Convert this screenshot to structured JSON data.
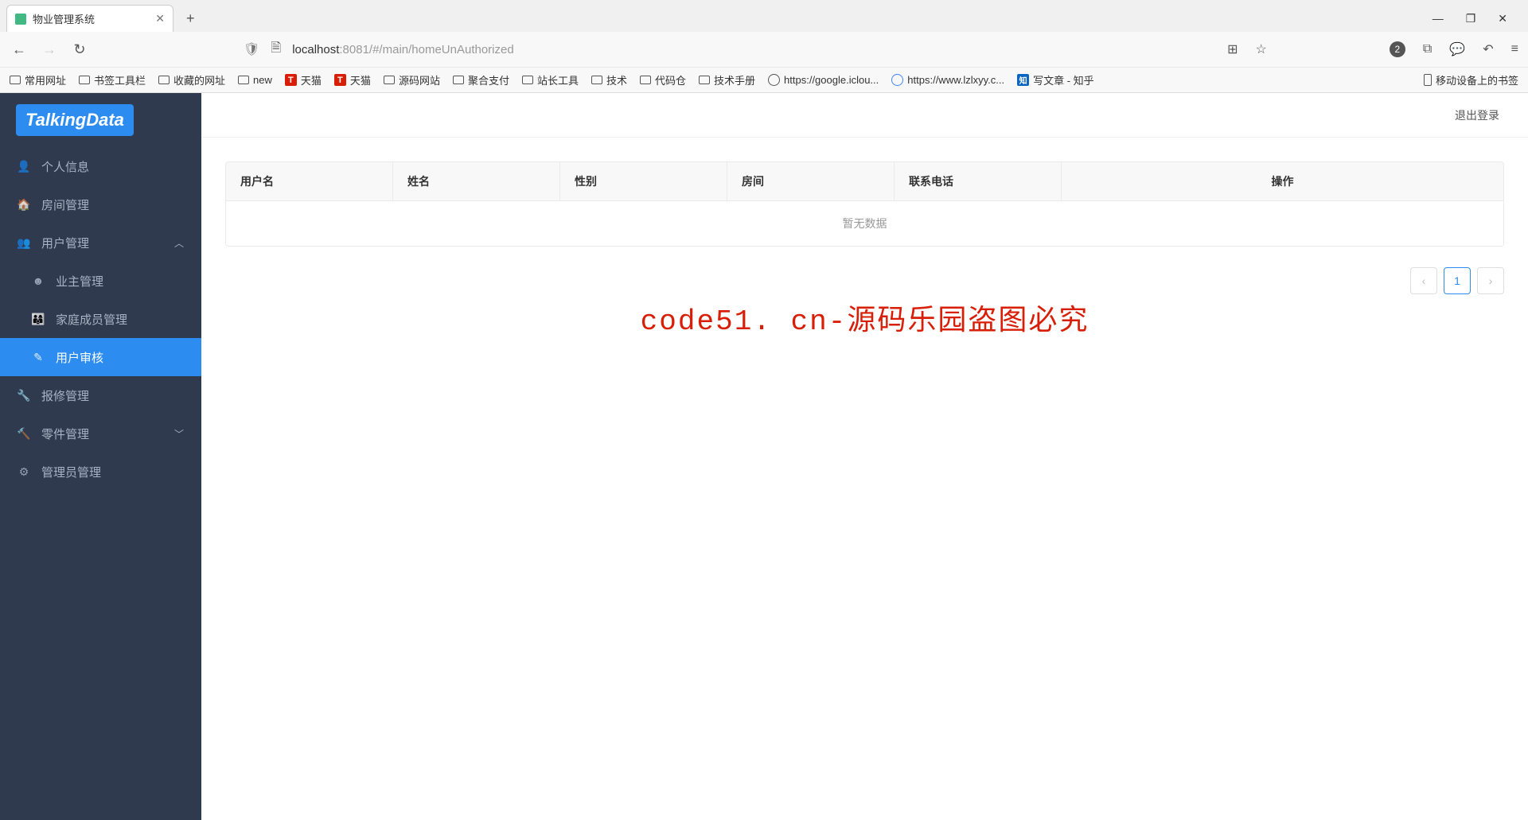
{
  "browser": {
    "tab_title": "物业管理系统",
    "url_prefix": "localhost",
    "url_rest": ":8081/#/main/homeUnAuthorized",
    "badge": "2",
    "bookmarks": [
      {
        "type": "folder",
        "label": "常用网址"
      },
      {
        "type": "folder",
        "label": "书签工具栏"
      },
      {
        "type": "folder",
        "label": "收藏的网址"
      },
      {
        "type": "folder",
        "label": "new"
      },
      {
        "type": "tmall",
        "label": "天猫"
      },
      {
        "type": "tmall",
        "label": "天猫"
      },
      {
        "type": "folder",
        "label": "源码网站"
      },
      {
        "type": "folder",
        "label": "聚合支付"
      },
      {
        "type": "folder",
        "label": "站长工具"
      },
      {
        "type": "folder",
        "label": "技术"
      },
      {
        "type": "folder",
        "label": "代码仓"
      },
      {
        "type": "folder",
        "label": "技术手册"
      },
      {
        "type": "globe",
        "label": "https://google.iclou..."
      },
      {
        "type": "google",
        "label": "https://www.lzlxyy.c..."
      },
      {
        "type": "zhihu",
        "label": "写文章 - 知乎"
      }
    ],
    "bookmark_right": "移动设备上的书签"
  },
  "app": {
    "logo": "TalkingData",
    "logout": "退出登录",
    "menu": {
      "personal": "个人信息",
      "room": "房间管理",
      "user": "用户管理",
      "owner": "业主管理",
      "family": "家庭成员管理",
      "audit": "用户审核",
      "repair": "报修管理",
      "parts": "零件管理",
      "admin": "管理员管理"
    },
    "table": {
      "headers": {
        "username": "用户名",
        "name": "姓名",
        "gender": "性别",
        "room": "房间",
        "phone": "联系电话",
        "operation": "操作"
      },
      "empty": "暂无数据"
    },
    "pagination": {
      "current": "1"
    },
    "watermark": "code51. cn-源码乐园盗图必究"
  }
}
